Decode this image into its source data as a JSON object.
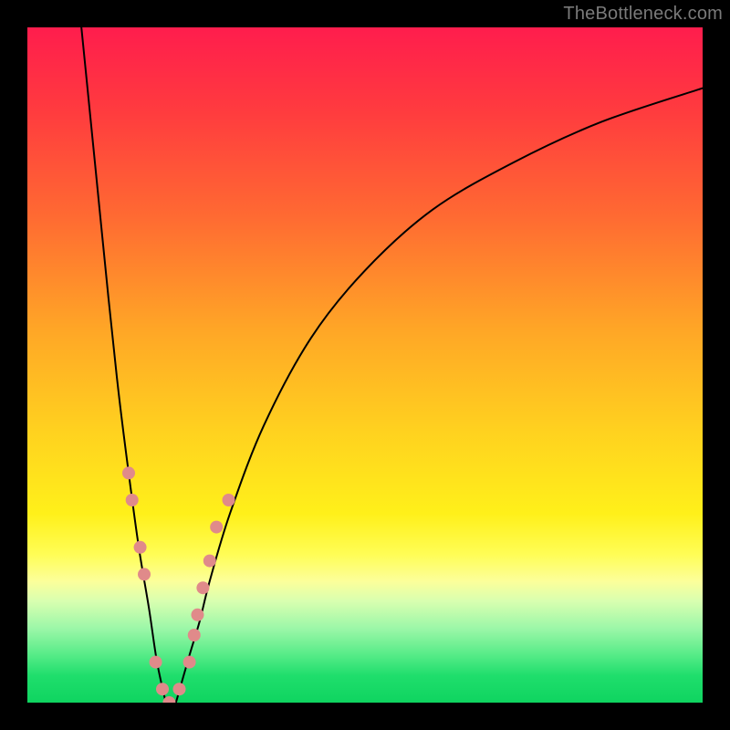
{
  "watermark": "TheBottleneck.com",
  "chart_data": {
    "type": "line",
    "title": "",
    "xlabel": "",
    "ylabel": "",
    "xlim": [
      0,
      100
    ],
    "ylim": [
      0,
      100
    ],
    "grid": false,
    "legend": false,
    "series": [
      {
        "name": "left-curve",
        "x": [
          8,
          10,
          12,
          13.5,
          15,
          16.5,
          18,
          19.2,
          20.5
        ],
        "values": [
          100,
          80,
          60,
          46,
          34,
          23,
          14,
          6,
          0
        ]
      },
      {
        "name": "right-curve",
        "x": [
          22,
          24,
          25.5,
          27,
          30,
          35,
          42,
          50,
          60,
          72,
          85,
          100
        ],
        "values": [
          0,
          7,
          12,
          18,
          28,
          41,
          54,
          64,
          73,
          80,
          86,
          91
        ]
      }
    ],
    "markers": {
      "name": "pink-dots",
      "color": "#e08a8a",
      "radius_px": 7,
      "points": [
        {
          "x": 15.0,
          "y": 34
        },
        {
          "x": 15.5,
          "y": 30
        },
        {
          "x": 16.7,
          "y": 23
        },
        {
          "x": 17.3,
          "y": 19
        },
        {
          "x": 19.0,
          "y": 6
        },
        {
          "x": 20.0,
          "y": 2
        },
        {
          "x": 21.0,
          "y": 0
        },
        {
          "x": 22.5,
          "y": 2
        },
        {
          "x": 24.0,
          "y": 6
        },
        {
          "x": 24.7,
          "y": 10
        },
        {
          "x": 25.2,
          "y": 13
        },
        {
          "x": 26.0,
          "y": 17
        },
        {
          "x": 27.0,
          "y": 21
        },
        {
          "x": 28.0,
          "y": 26
        },
        {
          "x": 29.8,
          "y": 30
        }
      ]
    },
    "background_gradient": {
      "top": "#ff1d4d",
      "upper_mid": "#ffa726",
      "mid": "#fff01a",
      "lower_mid": "#9cf7a8",
      "bottom": "#0fd460"
    }
  }
}
